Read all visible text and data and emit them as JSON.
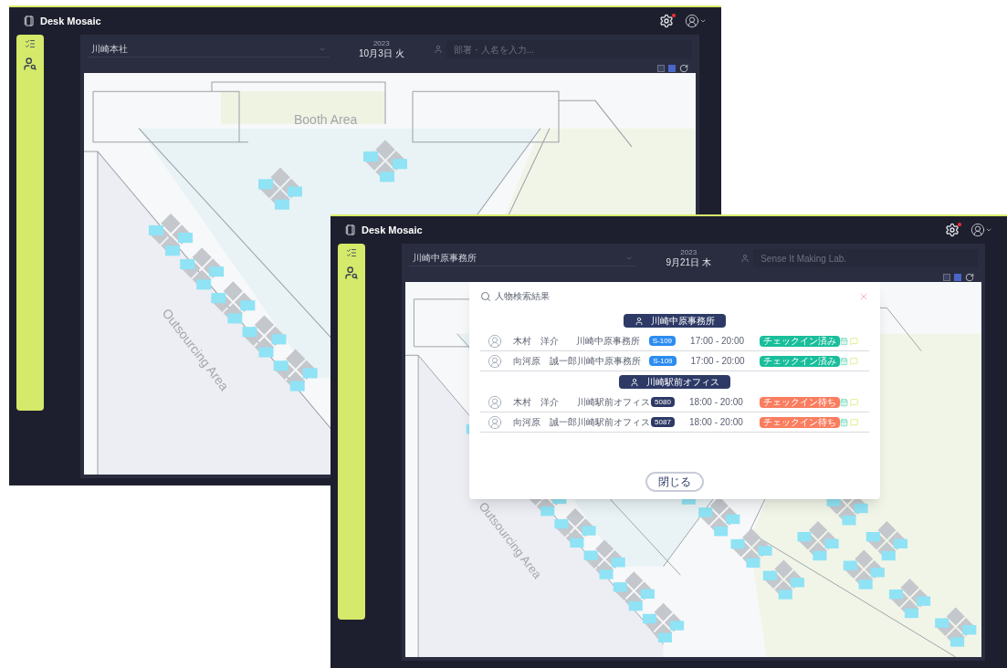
{
  "windows": [
    {
      "app_name": "Desk Mosaic",
      "location": "川崎本社",
      "year": "2023",
      "date": "10月3日 火",
      "search": {
        "placeholder": "部署・人名を入力..."
      },
      "areas": [
        {
          "label": "Booth Area",
          "kind": "booth"
        },
        {
          "label": "Outsourcing Area",
          "kind": "outsourcing"
        }
      ]
    },
    {
      "app_name": "Desk Mosaic",
      "location": "川崎中原事務所",
      "year": "2023",
      "date": "9月21日 木",
      "search": {
        "placeholder": "Sense It Making Lab."
      },
      "areas": [
        {
          "label": "Outsourcing Area",
          "kind": "outsourcing"
        }
      ],
      "dialog": {
        "title": "人物検索結果",
        "close_button": "閉じる",
        "groups": [
          {
            "label": "川崎中原事務所",
            "rows": [
              {
                "name": "木村　洋介",
                "location": "川崎中原事務所",
                "seat": {
                  "label": "S-109",
                  "color": "#2d8cf0"
                },
                "time": "17:00 - 20:00",
                "status": {
                  "label": "チェックイン済み",
                  "color": "#19be9b"
                }
              },
              {
                "name": "向河原　誠一郎",
                "location": "川崎中原事務所",
                "seat": {
                  "label": "S-109",
                  "color": "#2d8cf0"
                },
                "time": "17:00 - 20:00",
                "status": {
                  "label": "チェックイン済み",
                  "color": "#19be9b"
                }
              }
            ]
          },
          {
            "label": "川崎駅前オフィス",
            "rows": [
              {
                "name": "木村　洋介",
                "location": "川崎駅前オフィス",
                "seat": {
                  "label": "5080",
                  "color": "#2e3a66"
                },
                "time": "18:00 - 20:00",
                "status": {
                  "label": "チェックイン待ち",
                  "color": "#fa7d5f"
                }
              },
              {
                "name": "向河原　誠一郎",
                "location": "川崎駅前オフィス",
                "seat": {
                  "label": "5087",
                  "color": "#2e3a66"
                },
                "time": "18:00 - 20:00",
                "status": {
                  "label": "チェックイン待ち",
                  "color": "#fa7d5f"
                }
              }
            ]
          }
        ]
      }
    }
  ]
}
